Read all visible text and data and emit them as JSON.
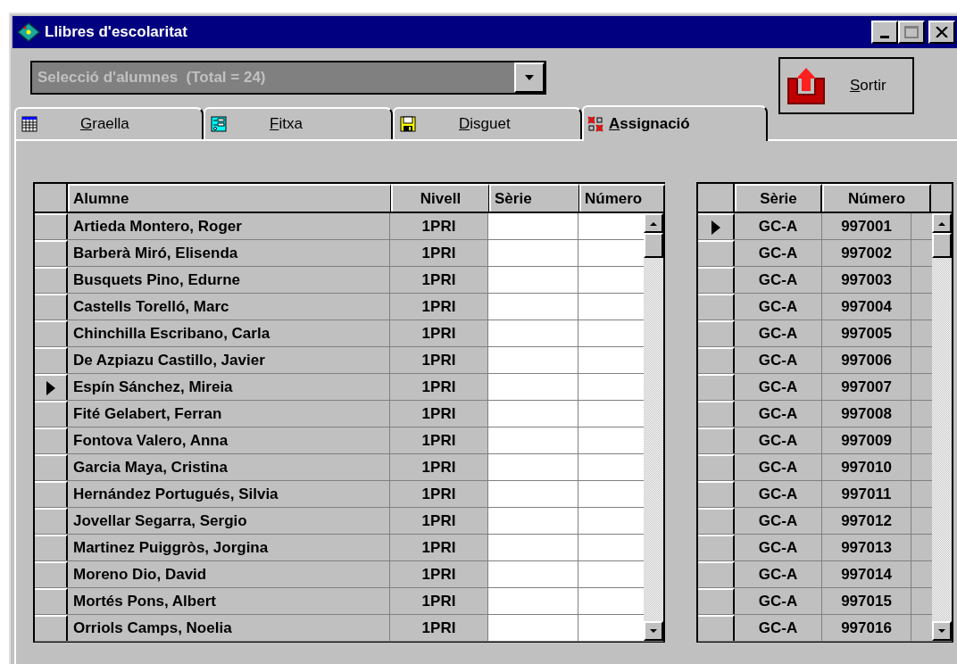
{
  "window": {
    "title": "Llibres d'escolaritat"
  },
  "selector": {
    "value": "Selecció d'alumnes  (Total = 24)",
    "disabled": true
  },
  "exit_button": {
    "label": "Sortir"
  },
  "tabs": [
    {
      "label": "Graella",
      "selected": false
    },
    {
      "label": "Fitxa",
      "selected": false
    },
    {
      "label": "Disguet",
      "selected": false
    },
    {
      "label": "Assignació",
      "selected": true
    }
  ],
  "students_grid": {
    "columns": [
      "Alumne",
      "Nivell",
      "Sèrie",
      "Número"
    ],
    "rows": [
      {
        "alumne": "Artieda Montero, Roger",
        "nivell": "1PRI",
        "selected": false
      },
      {
        "alumne": "Barberà Miró, Elisenda",
        "nivell": "1PRI",
        "selected": false
      },
      {
        "alumne": "Busquets Pino, Edurne",
        "nivell": "1PRI",
        "selected": false
      },
      {
        "alumne": "Castells Torelló, Marc",
        "nivell": "1PRI",
        "selected": false
      },
      {
        "alumne": "Chinchilla Escribano, Carla",
        "nivell": "1PRI",
        "selected": false
      },
      {
        "alumne": "De Azpiazu Castillo, Javier",
        "nivell": "1PRI",
        "selected": false
      },
      {
        "alumne": "Espín Sánchez, Mireia",
        "nivell": "1PRI",
        "selected": true
      },
      {
        "alumne": "Fité Gelabert, Ferran",
        "nivell": "1PRI",
        "selected": false
      },
      {
        "alumne": "Fontova Valero, Anna",
        "nivell": "1PRI",
        "selected": false
      },
      {
        "alumne": "Garcia Maya, Cristina",
        "nivell": "1PRI",
        "selected": false
      },
      {
        "alumne": "Hernández Portugués, Silvia",
        "nivell": "1PRI",
        "selected": false
      },
      {
        "alumne": "Jovellar Segarra, Sergio",
        "nivell": "1PRI",
        "selected": false
      },
      {
        "alumne": "Martinez Puiggròs, Jorgina",
        "nivell": "1PRI",
        "selected": false
      },
      {
        "alumne": "Moreno Dio, David",
        "nivell": "1PRI",
        "selected": false
      },
      {
        "alumne": "Mortés Pons, Albert",
        "nivell": "1PRI",
        "selected": false
      },
      {
        "alumne": "Orriols Camps, Noelia",
        "nivell": "1PRI",
        "selected": false
      }
    ]
  },
  "books_grid": {
    "columns": [
      "Sèrie",
      "Número"
    ],
    "rows": [
      {
        "serie": "GC-A",
        "numero": "997001",
        "selected": true
      },
      {
        "serie": "GC-A",
        "numero": "997002",
        "selected": false
      },
      {
        "serie": "GC-A",
        "numero": "997003",
        "selected": false
      },
      {
        "serie": "GC-A",
        "numero": "997004",
        "selected": false
      },
      {
        "serie": "GC-A",
        "numero": "997005",
        "selected": false
      },
      {
        "serie": "GC-A",
        "numero": "997006",
        "selected": false
      },
      {
        "serie": "GC-A",
        "numero": "997007",
        "selected": false
      },
      {
        "serie": "GC-A",
        "numero": "997008",
        "selected": false
      },
      {
        "serie": "GC-A",
        "numero": "997009",
        "selected": false
      },
      {
        "serie": "GC-A",
        "numero": "997010",
        "selected": false
      },
      {
        "serie": "GC-A",
        "numero": "997011",
        "selected": false
      },
      {
        "serie": "GC-A",
        "numero": "997012",
        "selected": false
      },
      {
        "serie": "GC-A",
        "numero": "997013",
        "selected": false
      },
      {
        "serie": "GC-A",
        "numero": "997014",
        "selected": false
      },
      {
        "serie": "GC-A",
        "numero": "997015",
        "selected": false
      },
      {
        "serie": "GC-A",
        "numero": "997016",
        "selected": false
      }
    ]
  }
}
